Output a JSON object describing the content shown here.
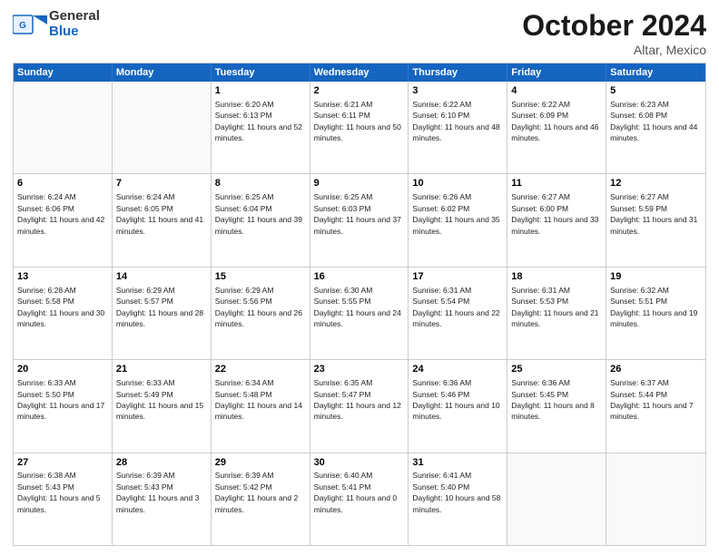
{
  "header": {
    "logo_general": "General",
    "logo_blue": "Blue",
    "month_title": "October 2024",
    "location": "Altar, Mexico"
  },
  "days_of_week": [
    "Sunday",
    "Monday",
    "Tuesday",
    "Wednesday",
    "Thursday",
    "Friday",
    "Saturday"
  ],
  "weeks": [
    [
      {
        "day": "",
        "sunrise": "",
        "sunset": "",
        "daylight": ""
      },
      {
        "day": "",
        "sunrise": "",
        "sunset": "",
        "daylight": ""
      },
      {
        "day": "1",
        "sunrise": "Sunrise: 6:20 AM",
        "sunset": "Sunset: 6:13 PM",
        "daylight": "Daylight: 11 hours and 52 minutes."
      },
      {
        "day": "2",
        "sunrise": "Sunrise: 6:21 AM",
        "sunset": "Sunset: 6:11 PM",
        "daylight": "Daylight: 11 hours and 50 minutes."
      },
      {
        "day": "3",
        "sunrise": "Sunrise: 6:22 AM",
        "sunset": "Sunset: 6:10 PM",
        "daylight": "Daylight: 11 hours and 48 minutes."
      },
      {
        "day": "4",
        "sunrise": "Sunrise: 6:22 AM",
        "sunset": "Sunset: 6:09 PM",
        "daylight": "Daylight: 11 hours and 46 minutes."
      },
      {
        "day": "5",
        "sunrise": "Sunrise: 6:23 AM",
        "sunset": "Sunset: 6:08 PM",
        "daylight": "Daylight: 11 hours and 44 minutes."
      }
    ],
    [
      {
        "day": "6",
        "sunrise": "Sunrise: 6:24 AM",
        "sunset": "Sunset: 6:06 PM",
        "daylight": "Daylight: 11 hours and 42 minutes."
      },
      {
        "day": "7",
        "sunrise": "Sunrise: 6:24 AM",
        "sunset": "Sunset: 6:05 PM",
        "daylight": "Daylight: 11 hours and 41 minutes."
      },
      {
        "day": "8",
        "sunrise": "Sunrise: 6:25 AM",
        "sunset": "Sunset: 6:04 PM",
        "daylight": "Daylight: 11 hours and 39 minutes."
      },
      {
        "day": "9",
        "sunrise": "Sunrise: 6:25 AM",
        "sunset": "Sunset: 6:03 PM",
        "daylight": "Daylight: 11 hours and 37 minutes."
      },
      {
        "day": "10",
        "sunrise": "Sunrise: 6:26 AM",
        "sunset": "Sunset: 6:02 PM",
        "daylight": "Daylight: 11 hours and 35 minutes."
      },
      {
        "day": "11",
        "sunrise": "Sunrise: 6:27 AM",
        "sunset": "Sunset: 6:00 PM",
        "daylight": "Daylight: 11 hours and 33 minutes."
      },
      {
        "day": "12",
        "sunrise": "Sunrise: 6:27 AM",
        "sunset": "Sunset: 5:59 PM",
        "daylight": "Daylight: 11 hours and 31 minutes."
      }
    ],
    [
      {
        "day": "13",
        "sunrise": "Sunrise: 6:28 AM",
        "sunset": "Sunset: 5:58 PM",
        "daylight": "Daylight: 11 hours and 30 minutes."
      },
      {
        "day": "14",
        "sunrise": "Sunrise: 6:29 AM",
        "sunset": "Sunset: 5:57 PM",
        "daylight": "Daylight: 11 hours and 28 minutes."
      },
      {
        "day": "15",
        "sunrise": "Sunrise: 6:29 AM",
        "sunset": "Sunset: 5:56 PM",
        "daylight": "Daylight: 11 hours and 26 minutes."
      },
      {
        "day": "16",
        "sunrise": "Sunrise: 6:30 AM",
        "sunset": "Sunset: 5:55 PM",
        "daylight": "Daylight: 11 hours and 24 minutes."
      },
      {
        "day": "17",
        "sunrise": "Sunrise: 6:31 AM",
        "sunset": "Sunset: 5:54 PM",
        "daylight": "Daylight: 11 hours and 22 minutes."
      },
      {
        "day": "18",
        "sunrise": "Sunrise: 6:31 AM",
        "sunset": "Sunset: 5:53 PM",
        "daylight": "Daylight: 11 hours and 21 minutes."
      },
      {
        "day": "19",
        "sunrise": "Sunrise: 6:32 AM",
        "sunset": "Sunset: 5:51 PM",
        "daylight": "Daylight: 11 hours and 19 minutes."
      }
    ],
    [
      {
        "day": "20",
        "sunrise": "Sunrise: 6:33 AM",
        "sunset": "Sunset: 5:50 PM",
        "daylight": "Daylight: 11 hours and 17 minutes."
      },
      {
        "day": "21",
        "sunrise": "Sunrise: 6:33 AM",
        "sunset": "Sunset: 5:49 PM",
        "daylight": "Daylight: 11 hours and 15 minutes."
      },
      {
        "day": "22",
        "sunrise": "Sunrise: 6:34 AM",
        "sunset": "Sunset: 5:48 PM",
        "daylight": "Daylight: 11 hours and 14 minutes."
      },
      {
        "day": "23",
        "sunrise": "Sunrise: 6:35 AM",
        "sunset": "Sunset: 5:47 PM",
        "daylight": "Daylight: 11 hours and 12 minutes."
      },
      {
        "day": "24",
        "sunrise": "Sunrise: 6:36 AM",
        "sunset": "Sunset: 5:46 PM",
        "daylight": "Daylight: 11 hours and 10 minutes."
      },
      {
        "day": "25",
        "sunrise": "Sunrise: 6:36 AM",
        "sunset": "Sunset: 5:45 PM",
        "daylight": "Daylight: 11 hours and 8 minutes."
      },
      {
        "day": "26",
        "sunrise": "Sunrise: 6:37 AM",
        "sunset": "Sunset: 5:44 PM",
        "daylight": "Daylight: 11 hours and 7 minutes."
      }
    ],
    [
      {
        "day": "27",
        "sunrise": "Sunrise: 6:38 AM",
        "sunset": "Sunset: 5:43 PM",
        "daylight": "Daylight: 11 hours and 5 minutes."
      },
      {
        "day": "28",
        "sunrise": "Sunrise: 6:39 AM",
        "sunset": "Sunset: 5:43 PM",
        "daylight": "Daylight: 11 hours and 3 minutes."
      },
      {
        "day": "29",
        "sunrise": "Sunrise: 6:39 AM",
        "sunset": "Sunset: 5:42 PM",
        "daylight": "Daylight: 11 hours and 2 minutes."
      },
      {
        "day": "30",
        "sunrise": "Sunrise: 6:40 AM",
        "sunset": "Sunset: 5:41 PM",
        "daylight": "Daylight: 11 hours and 0 minutes."
      },
      {
        "day": "31",
        "sunrise": "Sunrise: 6:41 AM",
        "sunset": "Sunset: 5:40 PM",
        "daylight": "Daylight: 10 hours and 58 minutes."
      },
      {
        "day": "",
        "sunrise": "",
        "sunset": "",
        "daylight": ""
      },
      {
        "day": "",
        "sunrise": "",
        "sunset": "",
        "daylight": ""
      }
    ]
  ]
}
